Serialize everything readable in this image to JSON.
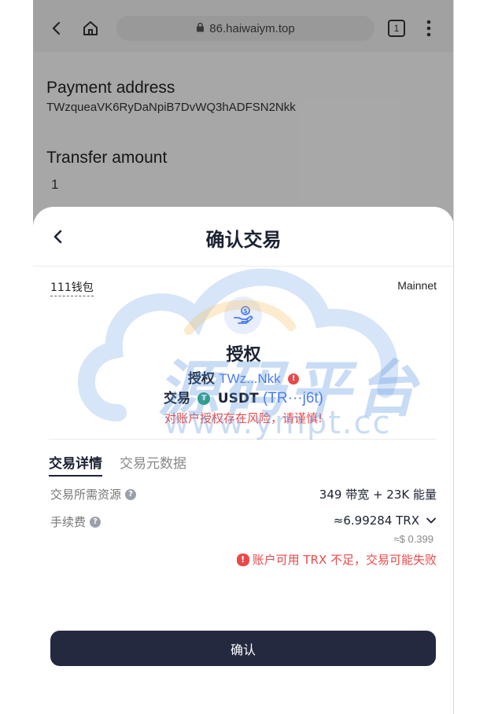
{
  "browser": {
    "url": "86.haiwaiym.top",
    "tab_count": "1"
  },
  "page": {
    "payment_label": "Payment address",
    "payment_value": "TWzqueaVK6RyDaNpiB7DvWQ3hADFSN2Nkk",
    "amount_label": "Transfer amount",
    "amount_value": "1"
  },
  "sheet": {
    "title": "确认交易",
    "wallet_name": "111钱包",
    "network": "Mainnet",
    "action_title": "授权",
    "auth_label": "授权",
    "auth_address": "TWz...Nkk",
    "trade_label": "交易",
    "trade_token": "USDT",
    "trade_address": "(TR···j6t)",
    "risk_warning": "对账户授权存在风险，请谨慎!",
    "tabs": [
      {
        "label": "交易详情"
      },
      {
        "label": "交易元数据"
      }
    ],
    "resource_label": "交易所需资源",
    "resource_value": "349 带宽 + 23K 能量",
    "fee_label": "手续费",
    "fee_value": "≈6.99284 TRX",
    "fee_usd": "≈$ 0.399",
    "insufficient_warning": "账户可用 TRX 不足，交易可能失败",
    "confirm_label": "确认"
  },
  "watermark": {
    "main": "源码平台",
    "sub": "www.ympt.cc"
  },
  "colors": {
    "accent_blue": "#4a7cf0",
    "danger_red": "#e84a4a",
    "button_dark": "#232a40",
    "tether_green": "#26a17b"
  }
}
